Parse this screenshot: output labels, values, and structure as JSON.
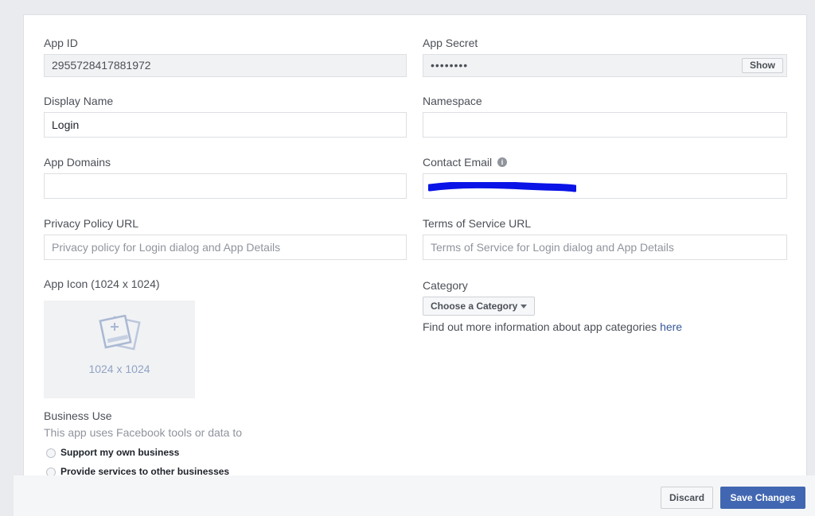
{
  "app_id": {
    "label": "App ID",
    "value": "2955728417881972"
  },
  "app_secret": {
    "label": "App Secret",
    "value": "••••••••",
    "show_label": "Show"
  },
  "display_name": {
    "label": "Display Name",
    "value": "Login"
  },
  "namespace": {
    "label": "Namespace",
    "value": ""
  },
  "app_domains": {
    "label": "App Domains",
    "value": ""
  },
  "contact_email": {
    "label": "Contact Email",
    "info_glyph": "i"
  },
  "privacy_policy": {
    "label": "Privacy Policy URL",
    "placeholder": "Privacy policy for Login dialog and App Details"
  },
  "terms_of_service": {
    "label": "Terms of Service URL",
    "placeholder": "Terms of Service for Login dialog and App Details"
  },
  "app_icon": {
    "label": "App Icon (1024 x 1024)",
    "size_text": "1024 x 1024",
    "icon": "image-upload-icon"
  },
  "category": {
    "label": "Category",
    "select_label": "Choose a Category",
    "info_text": "Find out more information about app categories ",
    "info_link": "here"
  },
  "business_use": {
    "label": "Business Use",
    "description": "This app uses Facebook tools or data to",
    "options": [
      {
        "label": "Support my own business"
      },
      {
        "label": "Provide services to other businesses"
      }
    ]
  },
  "footer": {
    "discard_label": "Discard",
    "save_label": "Save Changes"
  },
  "colors": {
    "primary": "#4267b2",
    "link": "#365899",
    "redaction": "#0a14e6",
    "background": "#e9ebee"
  }
}
